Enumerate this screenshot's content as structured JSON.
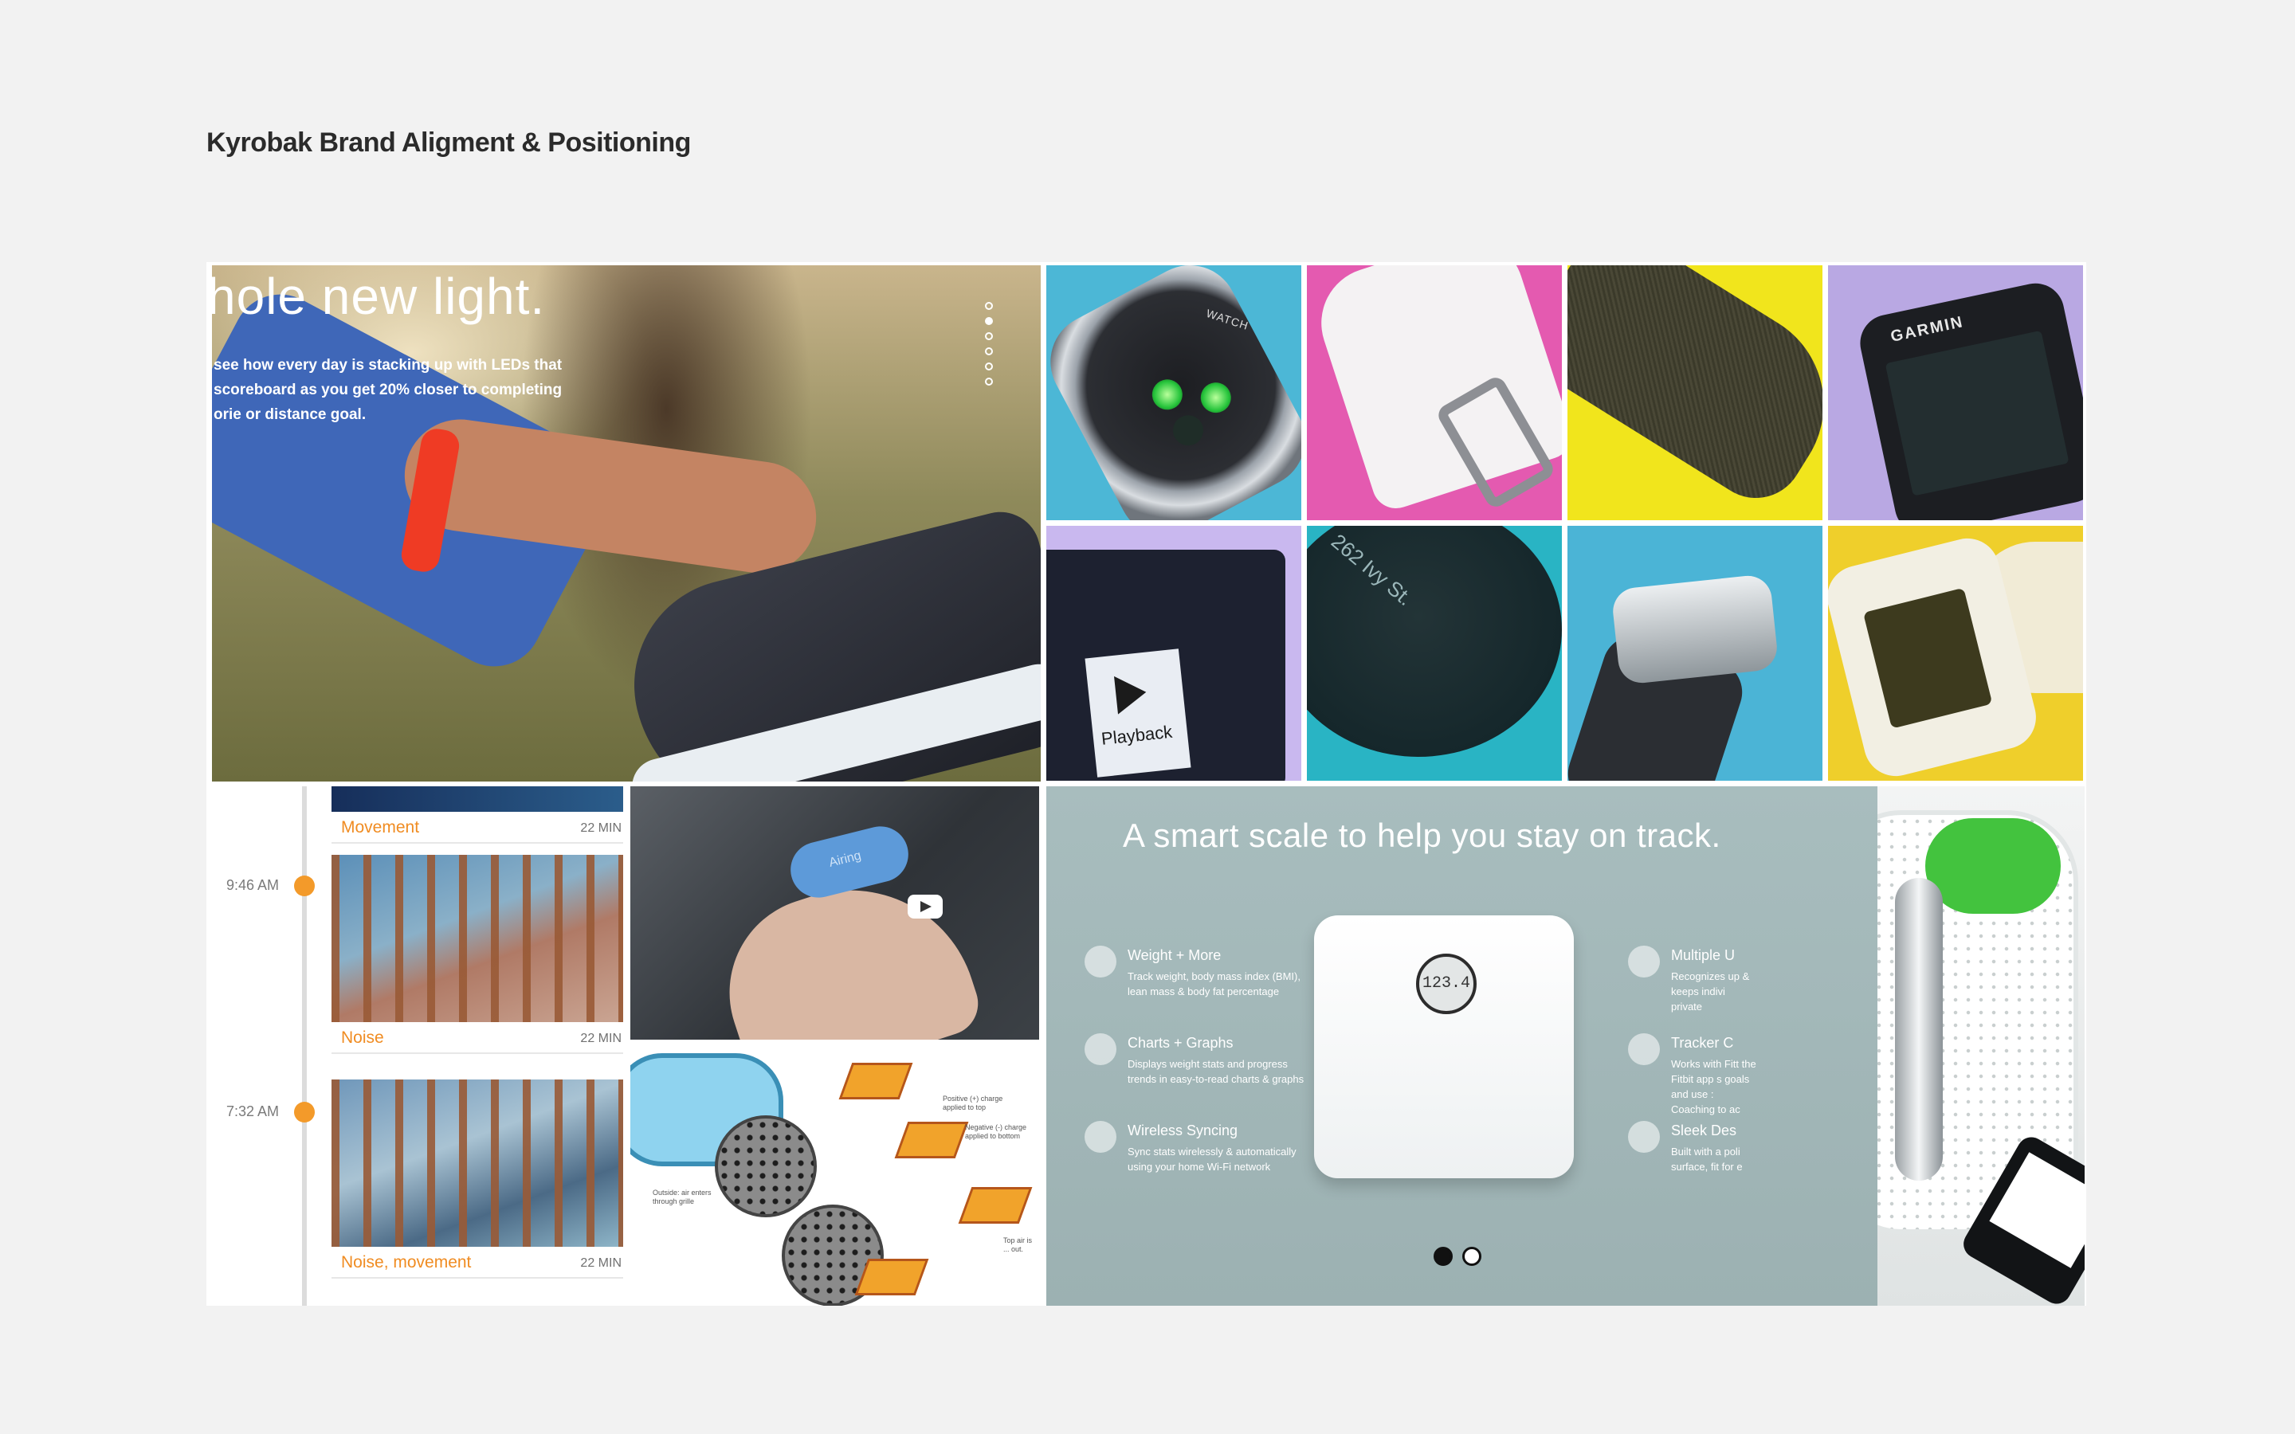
{
  "page": {
    "title": "Kyrobak Brand Aligment & Positioning"
  },
  "hero": {
    "headline": "hole new light.",
    "body": "see how every day is stacking up with LEDs that scoreboard as you get 20% closer to completing orie or distance goal.",
    "slide_count": 6,
    "active_slide": 1
  },
  "tiles": {
    "apple_watch": {
      "caption_text": "WATCH"
    },
    "pink_band": {},
    "yellow_band": {},
    "garmin": {
      "logo": "GARMIN"
    },
    "gopro": {
      "screen_label": "Playback"
    },
    "moto": {
      "text": "262 Ivy St."
    },
    "steel": {},
    "pebble": {}
  },
  "timeline": {
    "entries": [
      {
        "label": "Movement",
        "duration": "22 MIN",
        "time": ""
      },
      {
        "label": "Noise",
        "duration": "22 MIN",
        "time": "9:46 AM"
      },
      {
        "label": "Noise, movement",
        "duration": "22 MIN",
        "time": "7:32 AM"
      }
    ]
  },
  "video": {
    "device_label": "Airing"
  },
  "diagram": {
    "note_outside": "Outside: air enters through grille",
    "note_positive": "Positive (+) charge applied to top",
    "note_negative": "Negative (-) charge applied to bottom",
    "note_top": "Top air is ... out."
  },
  "scale": {
    "headline": "A smart scale to help you stay on track.",
    "readout": "123.4",
    "features_left": [
      {
        "title": "Weight + More",
        "desc": "Track weight, body mass index (BMI), lean mass & body fat percentage",
        "icon": "scale-icon"
      },
      {
        "title": "Charts + Graphs",
        "desc": "Displays weight stats and progress trends in easy-to-read charts & graphs",
        "icon": "chart-icon"
      },
      {
        "title": "Wireless Syncing",
        "desc": "Sync stats wirelessly & automatically using your home Wi-Fi network",
        "icon": "wifi-icon"
      }
    ],
    "features_right": [
      {
        "title": "Multiple U",
        "desc": "Recognizes up & keeps indivi private",
        "icon": "users-icon"
      },
      {
        "title": "Tracker C",
        "desc": "Works with Fitt the Fitbit app s goals and use : Coaching to ac",
        "icon": "tracker-icon"
      },
      {
        "title": "Sleek Des",
        "desc": "Built with a poli surface, fit for e",
        "icon": "design-icon"
      }
    ],
    "pager": {
      "count": 2,
      "active": 0
    }
  },
  "bp_monitor": {}
}
